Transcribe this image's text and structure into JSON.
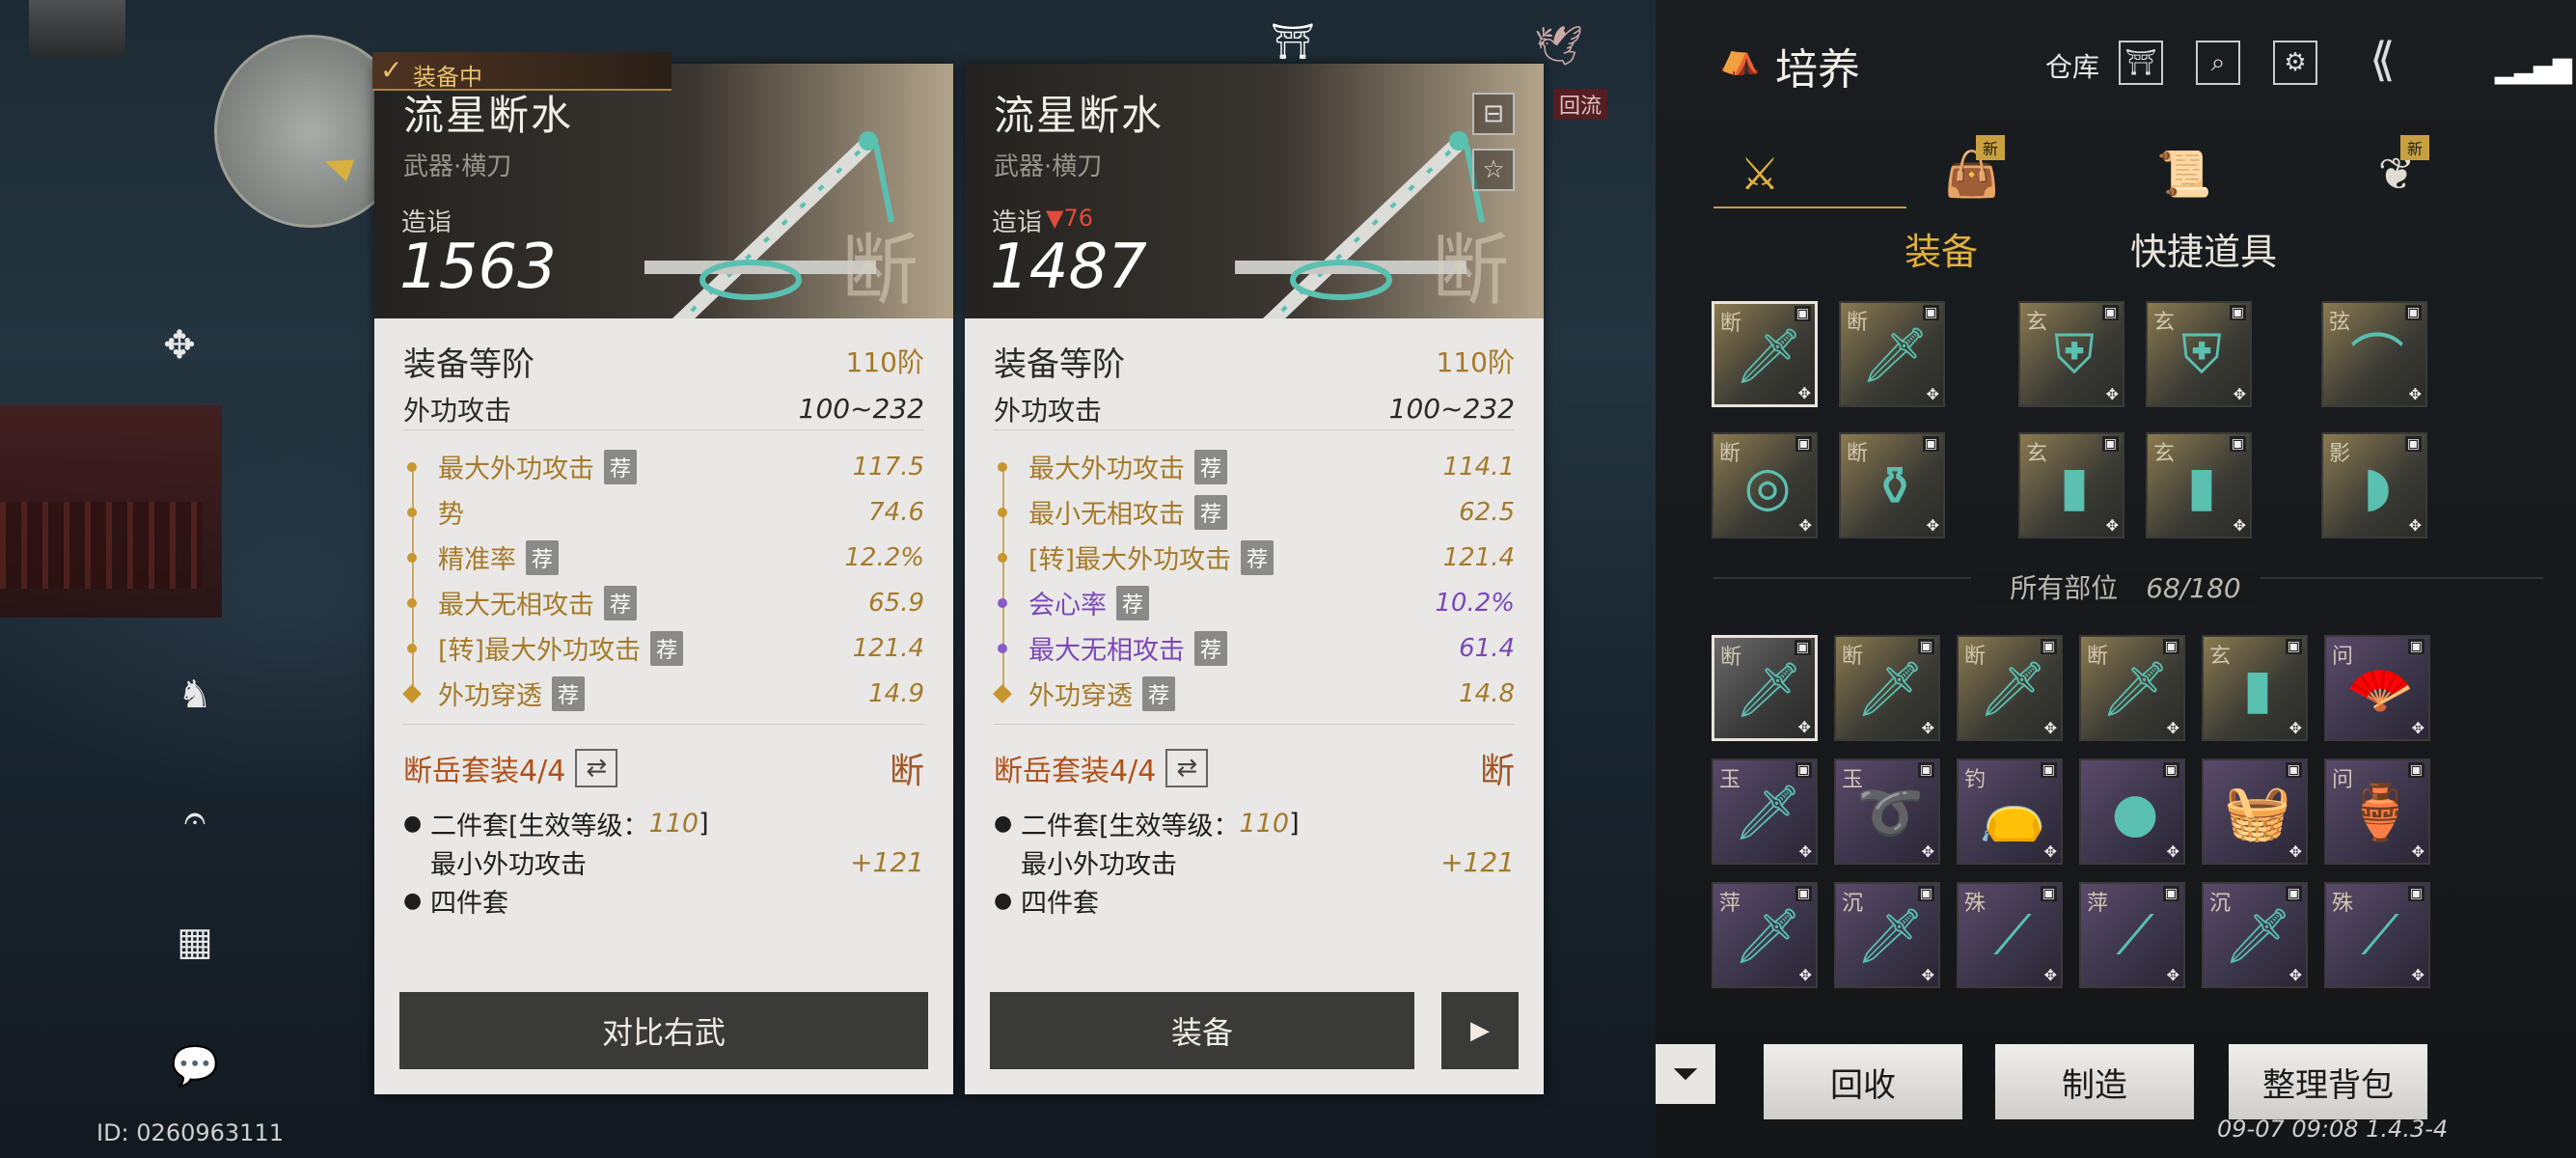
{
  "hud": {
    "player_id": "ID: 0260963111",
    "bird_label": "回流"
  },
  "card_left": {
    "equipped_tag": "装备中",
    "name": "流星断水",
    "type": "武器·横刀",
    "power_label": "造诣",
    "power": "1563",
    "power_diff": "",
    "tier_label": "装备等阶",
    "tier_value": "110阶",
    "attack_label": "外功攻击",
    "attack_value": "100~232",
    "stats": [
      {
        "label": "最大外功攻击",
        "rec": "荐",
        "value": "117.5",
        "color": "gold"
      },
      {
        "label": "势",
        "rec": "",
        "value": "74.6",
        "color": "gold"
      },
      {
        "label": "精准率",
        "rec": "荐",
        "value": "12.2%",
        "color": "gold"
      },
      {
        "label": "最大无相攻击",
        "rec": "荐",
        "value": "65.9",
        "color": "gold"
      },
      {
        "label": "[转]最大外功攻击",
        "rec": "荐",
        "value": "121.4",
        "color": "gold"
      },
      {
        "label": "外功穿透",
        "rec": "荐",
        "value": "14.9",
        "color": "gold"
      }
    ],
    "set_name": "断岳套装4/4",
    "set_mark": "断",
    "set_lines": {
      "two_piece_prefix": "二件套[生效等级：",
      "two_piece_level": "110",
      "two_piece_suffix": "]",
      "two_piece_effect": "最小外功攻击",
      "two_piece_value": "+121",
      "four_piece": "四件套"
    },
    "button": "对比右武"
  },
  "card_right": {
    "name": "流星断水",
    "type": "武器·横刀",
    "power_label": "造诣",
    "power": "1487",
    "power_diff": "▼76",
    "tier_label": "装备等阶",
    "tier_value": "110阶",
    "attack_label": "外功攻击",
    "attack_value": "100~232",
    "stats": [
      {
        "label": "最大外功攻击",
        "rec": "荐",
        "value": "114.1",
        "color": "gold"
      },
      {
        "label": "最小无相攻击",
        "rec": "荐",
        "value": "62.5",
        "color": "gold"
      },
      {
        "label": "[转]最大外功攻击",
        "rec": "荐",
        "value": "121.4",
        "color": "gold"
      },
      {
        "label": "会心率",
        "rec": "荐",
        "value": "10.2%",
        "color": "purple"
      },
      {
        "label": "最大无相攻击",
        "rec": "荐",
        "value": "61.4",
        "color": "purple"
      },
      {
        "label": "外功穿透",
        "rec": "荐",
        "value": "14.8",
        "color": "gold"
      }
    ],
    "set_name": "断岳套装4/4",
    "set_mark": "断",
    "set_lines": {
      "two_piece_prefix": "二件套[生效等级：",
      "two_piece_level": "110",
      "two_piece_suffix": "]",
      "two_piece_effect": "最小外功攻击",
      "two_piece_value": "+121",
      "four_piece": "四件套"
    },
    "button": "装备"
  },
  "panel": {
    "title": "培养",
    "warehouse": "仓库",
    "new_badge": "新",
    "tabs": [
      "装备",
      "快捷道具"
    ],
    "all_parts_label": "所有部位",
    "all_parts_count": "68/180",
    "buttons": {
      "recycle": "回收",
      "craft": "制造",
      "sort": "整理背包"
    },
    "version": "09-07 09:08 1.4.3-4",
    "equipped_slots": [
      {
        "glyph": "断",
        "art": "🗡",
        "style": "gold",
        "sel": true
      },
      {
        "glyph": "断",
        "art": "🗡",
        "style": "gold",
        "sel": false
      },
      {
        "glyph": "玄",
        "art": "⛨",
        "style": "gold",
        "sel": false
      },
      {
        "glyph": "玄",
        "art": "⛨",
        "style": "gold",
        "sel": false
      },
      {
        "glyph": "弦",
        "art": "⌒",
        "style": "gold",
        "sel": false
      },
      {
        "glyph": "断",
        "art": "◎",
        "style": "gold",
        "sel": false
      },
      {
        "glyph": "断",
        "art": "⚱",
        "style": "gold",
        "sel": false
      },
      {
        "glyph": "玄",
        "art": "▮",
        "style": "gold",
        "sel": false
      },
      {
        "glyph": "玄",
        "art": "▮",
        "style": "gold",
        "sel": false
      },
      {
        "glyph": "影",
        "art": "◗",
        "style": "gold",
        "sel": false
      }
    ],
    "bag_slots": [
      {
        "glyph": "断",
        "art": "🗡",
        "style": "white",
        "sel": true
      },
      {
        "glyph": "断",
        "art": "🗡",
        "style": "gold",
        "sel": false
      },
      {
        "glyph": "断",
        "art": "🗡",
        "style": "gold",
        "sel": false
      },
      {
        "glyph": "断",
        "art": "🗡",
        "style": "gold",
        "sel": false
      },
      {
        "glyph": "玄",
        "art": "▮",
        "style": "gold",
        "sel": false
      },
      {
        "glyph": "问",
        "art": "🪭",
        "style": "purple",
        "sel": false
      },
      {
        "glyph": "玉",
        "art": "🗡",
        "style": "purple",
        "sel": false
      },
      {
        "glyph": "玉",
        "art": "➰",
        "style": "purple",
        "sel": false
      },
      {
        "glyph": "钓",
        "art": "👝",
        "style": "purple",
        "sel": false
      },
      {
        "glyph": "",
        "art": "●",
        "style": "purple",
        "sel": false
      },
      {
        "glyph": "",
        "art": "🧺",
        "style": "purple",
        "sel": false
      },
      {
        "glyph": "问",
        "art": "🏺",
        "style": "purple",
        "sel": false
      },
      {
        "glyph": "萍",
        "art": "🗡",
        "style": "purple",
        "sel": false
      },
      {
        "glyph": "沉",
        "art": "🗡",
        "style": "purple",
        "sel": false
      },
      {
        "glyph": "殊",
        "art": "⟋",
        "style": "purple",
        "sel": false
      },
      {
        "glyph": "萍",
        "art": "⟋",
        "style": "purple",
        "sel": false
      },
      {
        "glyph": "沉",
        "art": "🗡",
        "style": "purple",
        "sel": false
      },
      {
        "glyph": "殊",
        "art": "⟋",
        "style": "purple",
        "sel": false
      }
    ]
  }
}
